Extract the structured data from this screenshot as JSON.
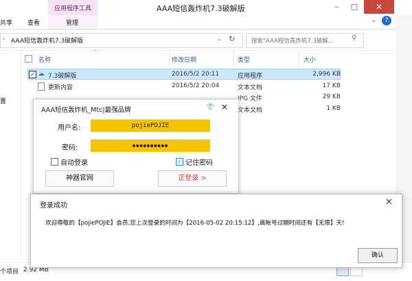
{
  "window": {
    "title": "AAA短信轰炸机7.3破解版",
    "context_tab_group": "应用程序工具",
    "minimize": "–",
    "maximize": "□",
    "close": "✕"
  },
  "ribbon": {
    "tabs": [
      "共享",
      "查看",
      "管理"
    ],
    "help": "?"
  },
  "address": {
    "path": "AAA短信轰炸机7.3破解版",
    "search_placeholder": "搜索\"AAA短信轰炸机7.3破解..."
  },
  "columns": {
    "name": "名称",
    "date": "修改日期",
    "type": "类型",
    "size": "大小"
  },
  "files": [
    {
      "name": "7.3破解版",
      "date": "2016/5/2 20:11",
      "type": "应用程序",
      "size": "2,996 KB"
    },
    {
      "name": "更新内容",
      "date": "2016/5/2 20:04",
      "type": "文本文档",
      "size": "17 KB"
    },
    {
      "name": "",
      "date": "",
      "type": "JPG 文件",
      "size": "29 KB"
    },
    {
      "name": "",
      "date": "",
      "type": "文本文档",
      "size": "1 KB"
    }
  ],
  "left_pane": {
    "item": "置"
  },
  "status": {
    "items": "个项目",
    "selected": "2.92 MB"
  },
  "login": {
    "title": "AAA短信轰炸机_Mtc|最强品牌",
    "username_label": "用户名:",
    "username_value": "pojiePOJIE",
    "password_label": "密码:",
    "password_value": "●●●●●●●●●●",
    "auto_login": "自动登录",
    "remember": "记住密码",
    "site_button": "神器官网",
    "login_button": "正登录 >"
  },
  "message": {
    "title": "登录成功",
    "text": "欢迎尊敬的【pojiePOJIE】会员,您上次登录的时间为【2016-05-02 20:15:12】,离帐号过期时间还有【无限】天!",
    "ok": "确认"
  },
  "colors": {
    "field_bg": "#f7c400",
    "accent_red": "#e0403c",
    "selection": "#cce8ff",
    "context_tab": "#f4e3f4"
  }
}
